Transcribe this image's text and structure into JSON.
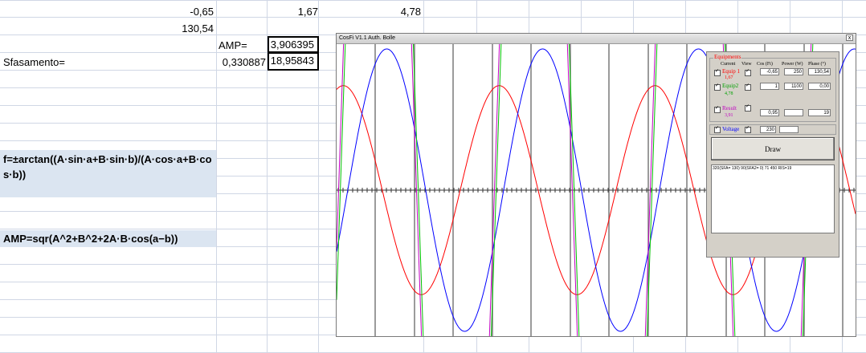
{
  "sheet": {
    "r1": {
      "a": "-0,65",
      "b": "1,67",
      "c": "4,78"
    },
    "r2": {
      "a": "130,54"
    },
    "r3": {
      "label": "AMP=",
      "value": "3,906395"
    },
    "r4": {
      "label": "Sfasamento=",
      "a": "0,330887",
      "value": "18,95843"
    },
    "formula_phase": "f=±arctan((A·sin·a+B·sin·b)/(A·cos·a+B·cos·b))",
    "formula_amp": "AMP=sqr(A^2+B^2+2A·B·cos(a−b))"
  },
  "app": {
    "title": "CosFi V1.1 Auth. Bolle",
    "close": "x",
    "panel": {
      "group_title": "Equipments",
      "col_current": "Current",
      "col_view": "View",
      "col_cos": "Cos (Fi)",
      "col_power": "Power (W)",
      "col_phase": "Phase (°)",
      "equip1": {
        "name": "Equip 1",
        "current": "1,67",
        "cos": "-0,65",
        "power": "250",
        "phase": "130,54"
      },
      "equip2": {
        "name": "Equip2",
        "current": "4,78",
        "cos": "1",
        "power": "1100",
        "phase": "0,00"
      },
      "result": {
        "name": "Result",
        "current": "3,91",
        "cos": "0,95",
        "power": "",
        "phase": "19"
      },
      "voltage": {
        "name": "Voltage",
        "value": "230",
        "extra": ""
      },
      "draw": "Draw",
      "output": "320(SFA= 130) 90(SFA2= 0)  71 450 RIS=19"
    },
    "colors": {
      "red": "#ff0000",
      "green": "#00c000",
      "blue": "#0000ff",
      "magenta": "#c000c0",
      "equip1": "#ff0000",
      "equip2": "#00a000",
      "result": "#c000c0",
      "voltage": "#0000ff"
    }
  }
}
